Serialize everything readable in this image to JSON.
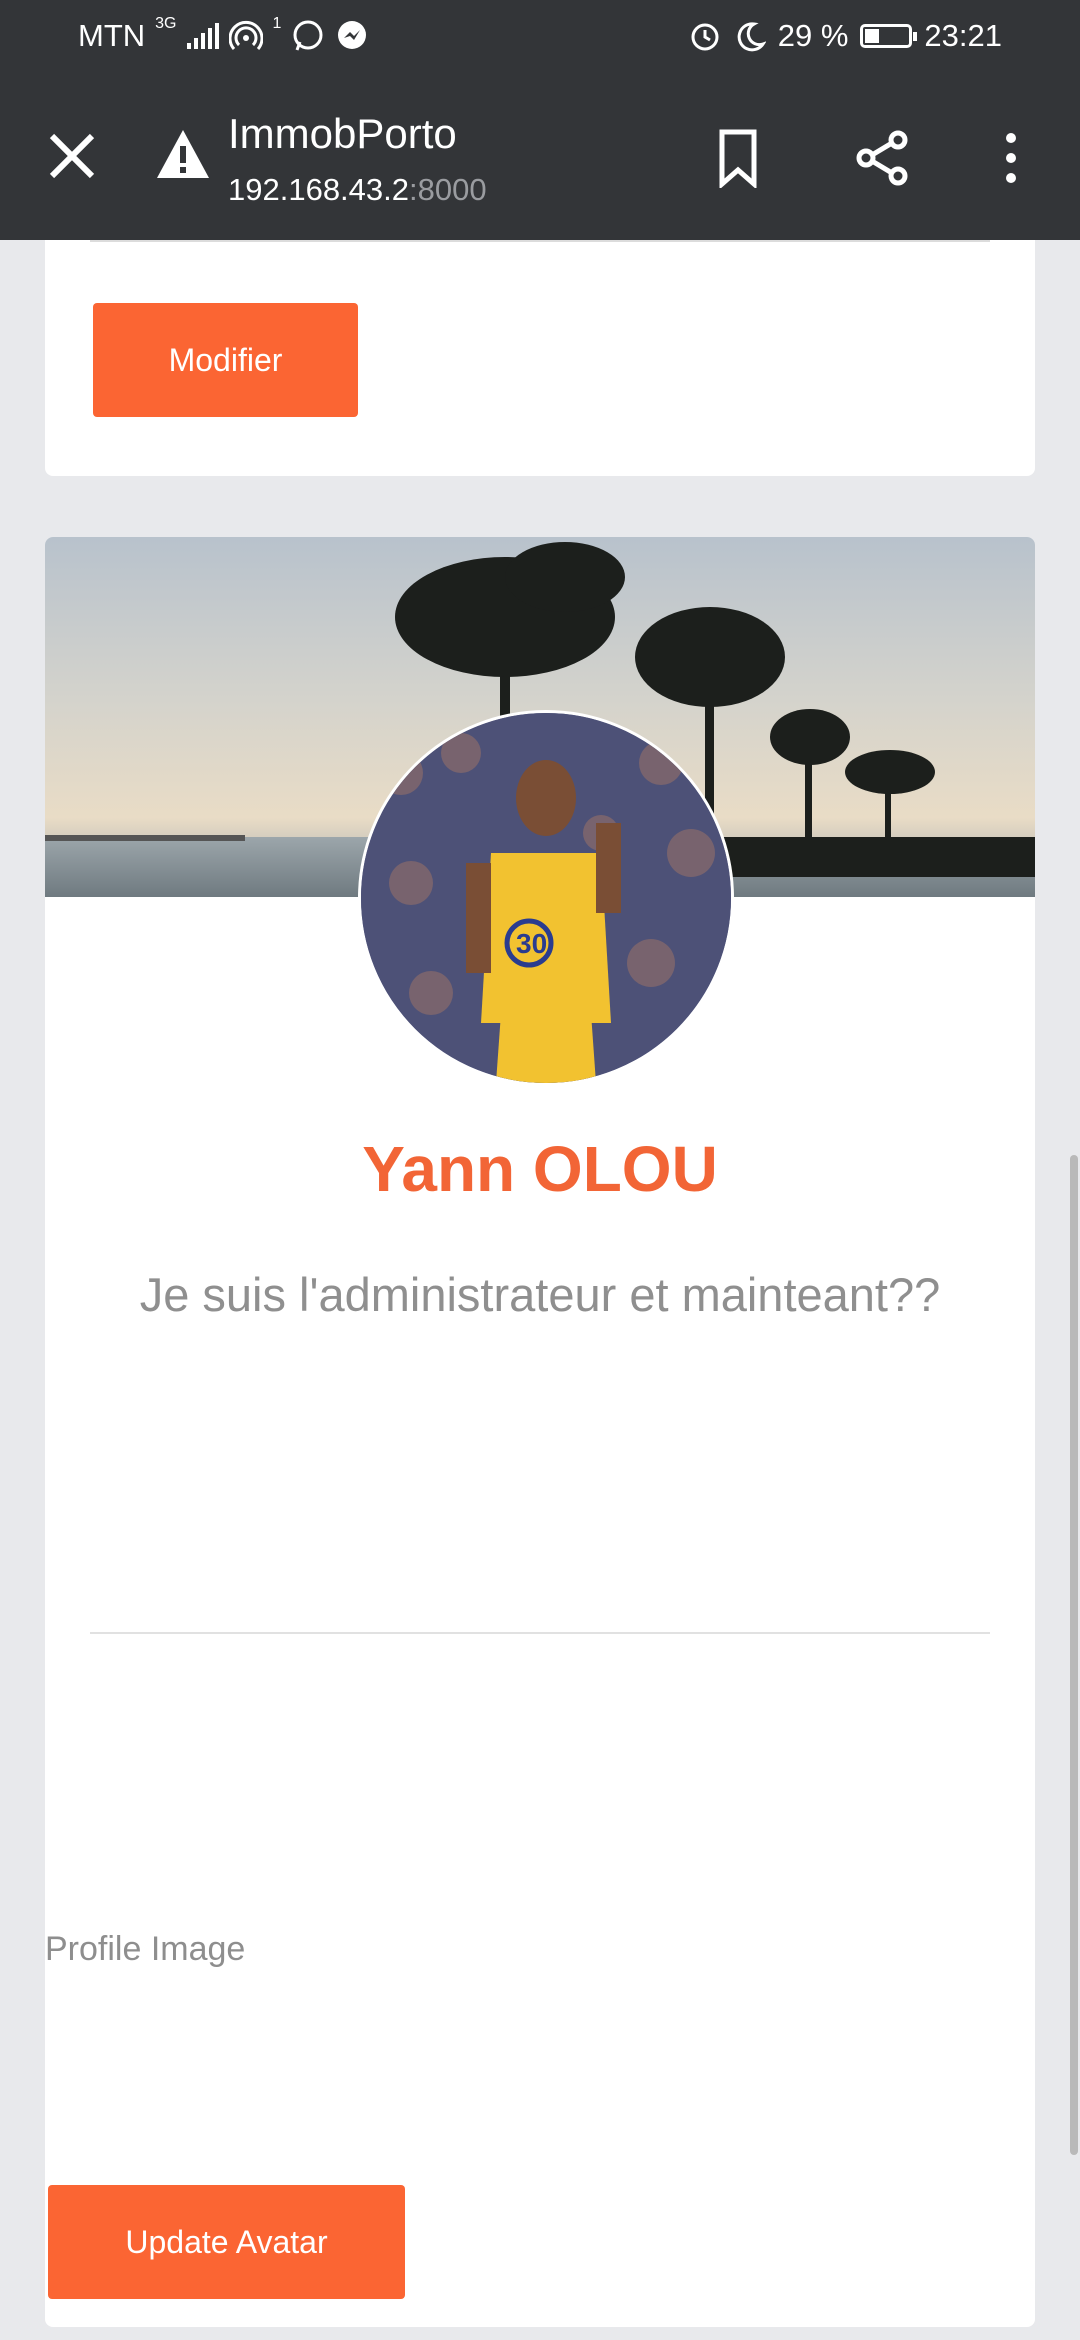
{
  "status_bar": {
    "carrier": "MTN",
    "network": "3G",
    "hotspot_count": "1",
    "battery": "29 %",
    "battery_level": 0.29,
    "time": "23:21"
  },
  "toolbar": {
    "site_title": "ImmobPorto",
    "url_host": "192.168.43.2",
    "url_port": ":8000"
  },
  "profile_form": {
    "modifier_label": "Modifier"
  },
  "profile_card": {
    "name": "Yann OLOU",
    "bio": "Je suis l'administrateur et mainteant??",
    "image_label": "Profile Image",
    "update_avatar_label": "Update Avatar"
  },
  "colors": {
    "accent": "#fb6533",
    "name_color": "#f26536",
    "topbar": "#333538"
  }
}
